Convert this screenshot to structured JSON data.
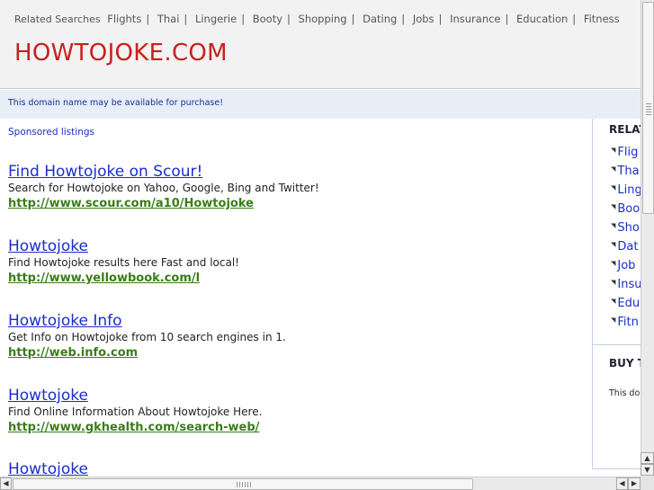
{
  "header": {
    "related_label": "Related Searches",
    "related_links": [
      "Flights",
      "Thai",
      "Lingerie",
      "Booty",
      "Shopping",
      "Dating",
      "Jobs",
      "Insurance",
      "Education",
      "Fitness"
    ],
    "site_title": "HOWTOJOKE.COM"
  },
  "notice": "This domain name may be available for purchase!",
  "main": {
    "sponsored_label": "Sponsored listings",
    "listings": [
      {
        "title": "Find Howtojoke on Scour!",
        "description": "Search for Howtojoke on Yahoo, Google, Bing and Twitter!",
        "url": "http://www.scour.com/a10/Howtojoke"
      },
      {
        "title": "Howtojoke",
        "description": "Find Howtojoke results here Fast and local!",
        "url": "http://www.yellowbook.com/l"
      },
      {
        "title": "Howtojoke Info",
        "description": "Get Info on Howtojoke from 10 search engines in 1.",
        "url": "http://web.info.com"
      },
      {
        "title": "Howtojoke",
        "description": "Find Online Information About Howtojoke Here.",
        "url": "http://www.gkhealth.com/search-web/"
      },
      {
        "title": "Howtojoke",
        "description": "",
        "url": ""
      }
    ]
  },
  "sidebar": {
    "heading": "RELAT",
    "items": [
      "Flig",
      "Tha",
      "Ling",
      "Boo",
      "Sho",
      "Dat",
      "Job",
      "Insu",
      "Edu",
      "Fitn"
    ],
    "buy_heading": "BUY T",
    "buy_text": "This dor"
  },
  "icons": {
    "list_bullet": "arrow-icon",
    "scroll_up": "chevron-up-icon",
    "scroll_down": "chevron-down-icon",
    "scroll_left": "chevron-left-icon",
    "scroll_right": "chevron-right-icon"
  },
  "colors": {
    "title_red": "#c8201d",
    "link_blue": "#1a2ec8",
    "url_green": "#3a7d1a",
    "notice_bg": "#e8eef8"
  }
}
